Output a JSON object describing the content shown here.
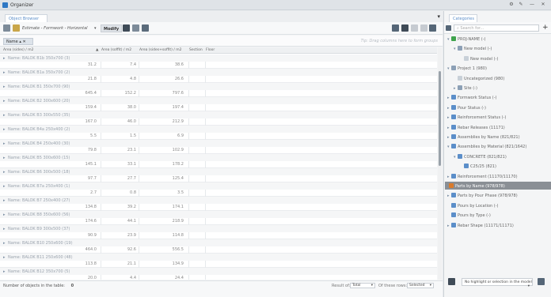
{
  "window": {
    "title": "Organizer"
  },
  "left": {
    "tab": "Object Browser",
    "toolbar": {
      "filter_text": "Estimate - Formwork - Horizontal",
      "modify_label": "Modify"
    },
    "group_chip": "Name",
    "group_hint": "Tip: Drag columns here to form groups",
    "columns": [
      "Area (sides) / m2",
      "Area (soffit) / m2",
      "Area (sides+soffit) / m2",
      "Section",
      "Floor"
    ],
    "rows": [
      {
        "name": "Name: BALOK B1b 350x700 (3)",
        "sides": "31.2",
        "soffit": "7.4",
        "total": "38.6"
      },
      {
        "name": "Name: BALOK B1a 350x700 (2)",
        "sides": "21.8",
        "soffit": "4.8",
        "total": "26.6"
      },
      {
        "name": "Name: BALOK B1 350x700 (90)",
        "sides": "645.4",
        "soffit": "152.2",
        "total": "797.6"
      },
      {
        "name": "Name: BALOK B2 300x600 (20)",
        "sides": "159.4",
        "soffit": "38.0",
        "total": "197.4"
      },
      {
        "name": "Name: BALOK B3 300x550 (35)",
        "sides": "167.0",
        "soffit": "46.0",
        "total": "212.9"
      },
      {
        "name": "Name: BALOK B4a 250x400 (2)",
        "sides": "5.5",
        "soffit": "1.5",
        "total": "6.9"
      },
      {
        "name": "Name: BALOK B4 250x400 (30)",
        "sides": "79.8",
        "soffit": "23.1",
        "total": "102.9"
      },
      {
        "name": "Name: BALOK B5 300x600 (15)",
        "sides": "145.1",
        "soffit": "33.1",
        "total": "178.2"
      },
      {
        "name": "Name: BALOK B6 300x500 (18)",
        "sides": "97.7",
        "soffit": "27.7",
        "total": "125.4"
      },
      {
        "name": "Name: BALOK B7a 250x400 (1)",
        "sides": "2.7",
        "soffit": "0.8",
        "total": "3.5"
      },
      {
        "name": "Name: BALOK B7 250x400 (27)",
        "sides": "134.8",
        "soffit": "39.2",
        "total": "174.1"
      },
      {
        "name": "Name: BALOK B8 350x600 (56)",
        "sides": "174.6",
        "soffit": "44.1",
        "total": "218.9"
      },
      {
        "name": "Name: BALOK B9 300x500 (37)",
        "sides": "90.9",
        "soffit": "23.9",
        "total": "114.8"
      },
      {
        "name": "Name: BALOK B10 250x600 (19)",
        "sides": "464.0",
        "soffit": "92.6",
        "total": "556.5"
      },
      {
        "name": "Name: BALOK B11 250x600 (48)",
        "sides": "113.8",
        "soffit": "21.1",
        "total": "134.9"
      },
      {
        "name": "Name: BALOK B12 350x700 (5)",
        "sides": "20.0",
        "soffit": "4.4",
        "total": "24.4"
      }
    ],
    "footer": {
      "count_label": "Number of objects in the table:",
      "count_value": "0",
      "result_label": "Result of:",
      "result_value": "Total",
      "rows_label": "Of these rows:",
      "rows_value": "Selected"
    }
  },
  "right": {
    "tab": "Categories",
    "search_placeholder": "Search for...",
    "tree": [
      {
        "label": "PROJ-NAME (-)",
        "indent": 0,
        "exp": "▾",
        "icon": "#3fa34d"
      },
      {
        "label": "New model (-)",
        "indent": 1,
        "exp": "▾",
        "icon": "#8ca0b6"
      },
      {
        "label": "New model (-)",
        "indent": 2,
        "exp": "",
        "icon": "#c8d0d8"
      },
      {
        "label": "Project 1 (980)",
        "indent": 0,
        "exp": "▾",
        "icon": "#8ca0b6"
      },
      {
        "label": "Uncategorized (980)",
        "indent": 1,
        "exp": "",
        "icon": "#c8d0d8"
      },
      {
        "label": "Site (-)",
        "indent": 1,
        "exp": "▸",
        "icon": "#8ca0b6"
      },
      {
        "label": "Formwork Status (-)",
        "indent": 0,
        "exp": "▸",
        "icon": "#5b8ec9"
      },
      {
        "label": "Pour Status (-)",
        "indent": 0,
        "exp": "▸",
        "icon": "#5b8ec9"
      },
      {
        "label": "Reinforcement Status (-)",
        "indent": 0,
        "exp": "▸",
        "icon": "#5b8ec9"
      },
      {
        "label": "Rebar Releases (11171)",
        "indent": 0,
        "exp": "▸",
        "icon": "#5b8ec9"
      },
      {
        "label": "Assemblies by Name (821/821)",
        "indent": 0,
        "exp": "▸",
        "icon": "#5b8ec9"
      },
      {
        "label": "Assemblies by Material (821/1642)",
        "indent": 0,
        "exp": "▾",
        "icon": "#5b8ec9"
      },
      {
        "label": "CONCRETE (821/821)",
        "indent": 1,
        "exp": "▾",
        "icon": "#5b8ec9"
      },
      {
        "label": "C25/25 (821)",
        "indent": 2,
        "exp": "",
        "icon": "#5b8ec9"
      },
      {
        "label": "Reinforcement (11170/11170)",
        "indent": 0,
        "exp": "▸",
        "icon": "#5b8ec9"
      },
      {
        "label": "Parts by Name (978/978)",
        "indent": 0,
        "exp": "▸",
        "icon": "#d97a2b",
        "selected": true
      },
      {
        "label": "Parts by Pour Phase (978/978)",
        "indent": 0,
        "exp": "▸",
        "icon": "#5b8ec9"
      },
      {
        "label": "Pours by Location (-)",
        "indent": 0,
        "exp": "",
        "icon": "#5b8ec9"
      },
      {
        "label": "Pours by Type (-)",
        "indent": 0,
        "exp": "",
        "icon": "#5b8ec9"
      },
      {
        "label": "Rebar Shape (11171/11171)",
        "indent": 0,
        "exp": "▸",
        "icon": "#5b8ec9"
      }
    ],
    "highlight_select": "No highlight or selection in the model"
  }
}
